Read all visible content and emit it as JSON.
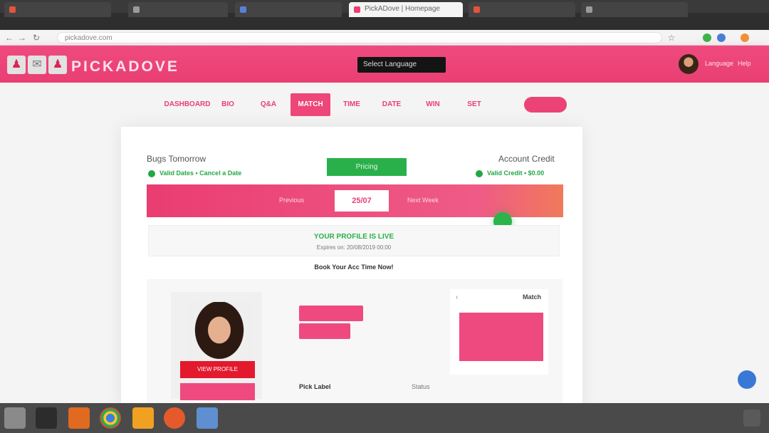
{
  "browser": {
    "tabs": [
      {
        "label": "",
        "color": "#e0553b"
      },
      {
        "label": "",
        "color": "#5b7fd6"
      },
      {
        "label": "",
        "color": "#9a9a9a"
      },
      {
        "label": "PickADove | Homepage",
        "color": "#e93f73",
        "active": true
      },
      {
        "label": "",
        "color": "#e0553b"
      },
      {
        "label": "",
        "color": "#9a9a9a"
      }
    ],
    "url": "pickadove.com"
  },
  "header": {
    "brand": "PICKADOVE",
    "language_select": "Select Language",
    "links": [
      "Language",
      "Help"
    ],
    "colors": {
      "primary": "#e93f73",
      "green": "#2ab04a"
    }
  },
  "steps": {
    "items": [
      "DASHBOARD",
      "BIO",
      "Q&A",
      "MATCH",
      "TIME",
      "DATE",
      "WIN",
      "SET"
    ],
    "active_index": 3
  },
  "status": {
    "left_title": "Bugs Tomorrow",
    "right_title": "Account Credit",
    "left_stat": "Valid Dates   •   Cancel a Date",
    "right_stat": "Valid Credit   •   $0.00",
    "green_button": "Pricing"
  },
  "bar": {
    "prev_label": "Previous",
    "date": "25/07",
    "next_label": "Next Week"
  },
  "live": {
    "title": "YOUR PROFILE IS LIVE",
    "subtitle": "Expires on: 20/08/2019 00:00",
    "tagline": "Book Your Acc Time Now!"
  },
  "profile": {
    "photo_label": "VIEW PROFILE",
    "right_box_title": "Match",
    "bottom_left": "Pick Label",
    "bottom_right": "Status"
  }
}
